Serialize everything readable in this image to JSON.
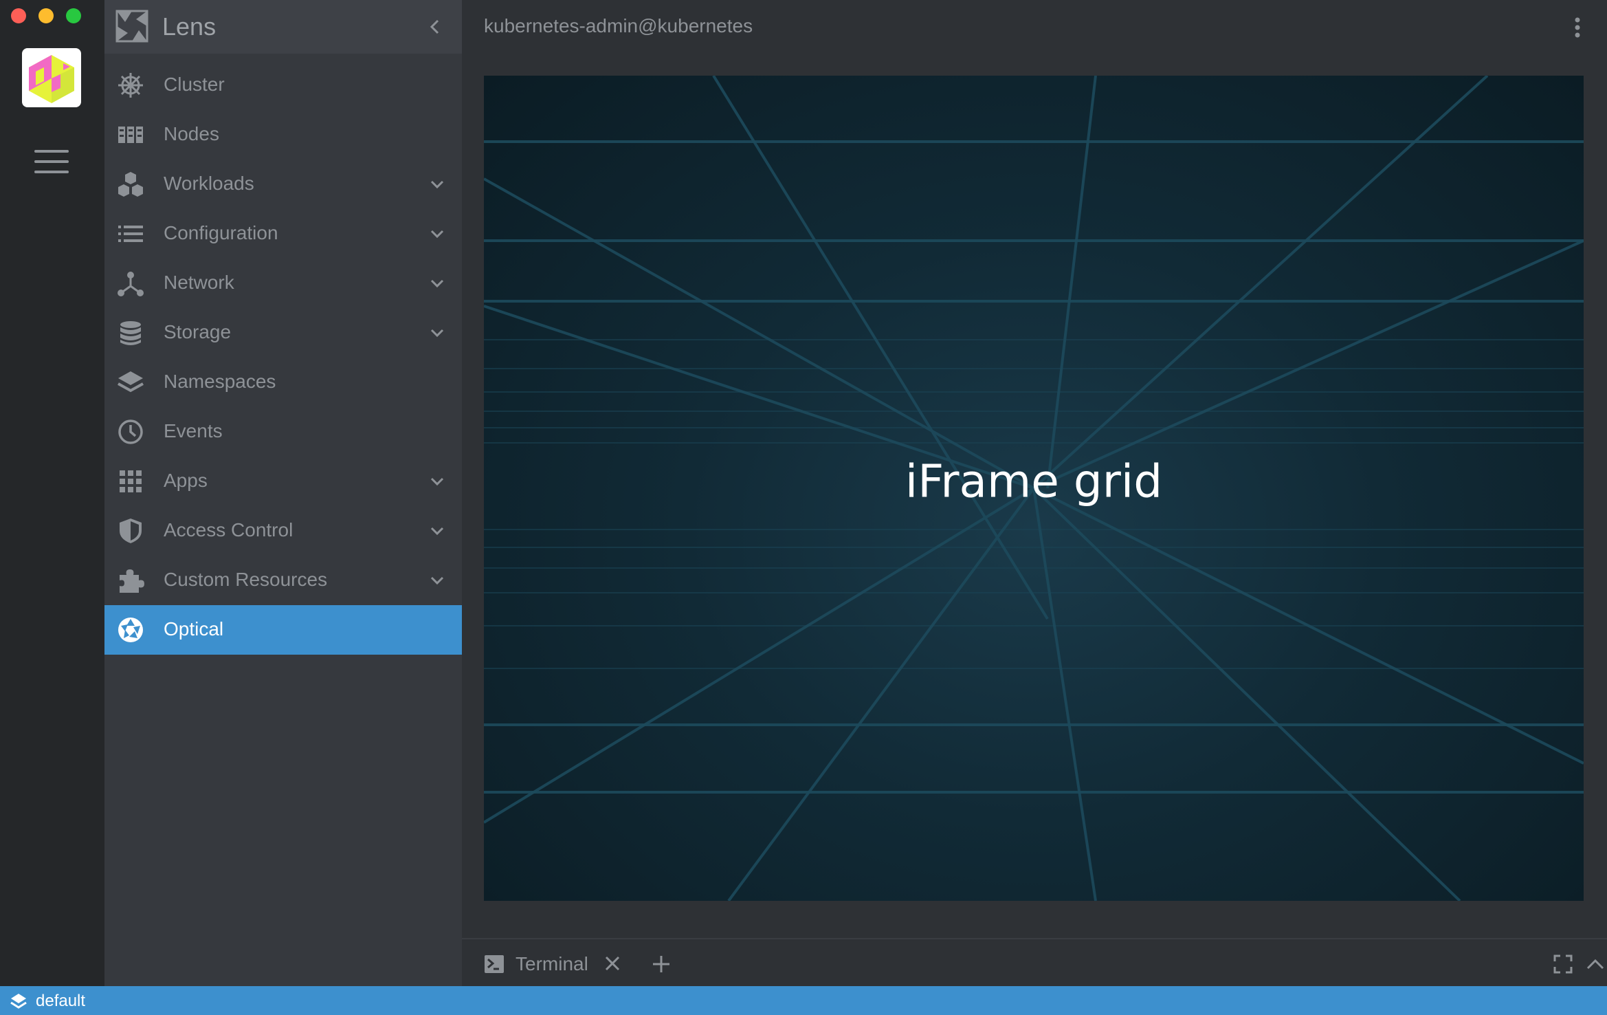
{
  "window": {
    "controls": [
      "close",
      "minimize",
      "maximize"
    ]
  },
  "rail": {
    "cluster_icon": "cluster-avatar-icon",
    "menu_icon": "hamburger-icon"
  },
  "sidebar": {
    "title": "Lens",
    "items": [
      {
        "label": "Cluster",
        "icon": "helm-wheel-icon",
        "expandable": false,
        "active": false
      },
      {
        "label": "Nodes",
        "icon": "nodes-icon",
        "expandable": false,
        "active": false
      },
      {
        "label": "Workloads",
        "icon": "cubes-icon",
        "expandable": true,
        "active": false
      },
      {
        "label": "Configuration",
        "icon": "list-icon",
        "expandable": true,
        "active": false
      },
      {
        "label": "Network",
        "icon": "network-icon",
        "expandable": true,
        "active": false
      },
      {
        "label": "Storage",
        "icon": "database-icon",
        "expandable": true,
        "active": false
      },
      {
        "label": "Namespaces",
        "icon": "layers-icon",
        "expandable": false,
        "active": false
      },
      {
        "label": "Events",
        "icon": "clock-icon",
        "expandable": false,
        "active": false
      },
      {
        "label": "Apps",
        "icon": "apps-grid-icon",
        "expandable": true,
        "active": false
      },
      {
        "label": "Access Control",
        "icon": "shield-icon",
        "expandable": true,
        "active": false
      },
      {
        "label": "Custom Resources",
        "icon": "puzzle-icon",
        "expandable": true,
        "active": false
      },
      {
        "label": "Optical",
        "icon": "aperture-icon",
        "expandable": false,
        "active": true
      }
    ]
  },
  "header": {
    "context": "kubernetes-admin@kubernetes"
  },
  "content": {
    "iframe_title": "iFrame grid"
  },
  "dock": {
    "tab_label": "Terminal"
  },
  "statusbar": {
    "namespace": "default"
  },
  "colors": {
    "accent": "#3d90ce",
    "sidebar_bg": "#36393e",
    "main_bg": "#2e3135",
    "rail_bg": "#252729",
    "text_muted": "#8e9297"
  }
}
